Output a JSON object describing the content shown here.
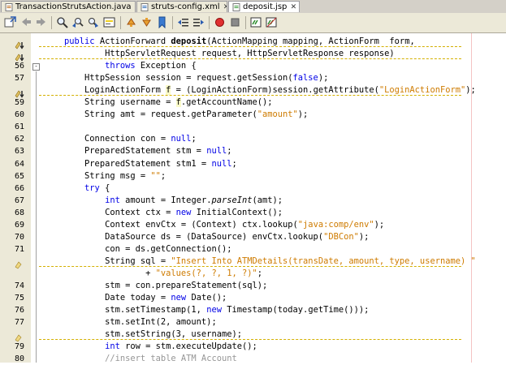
{
  "tabs": [
    {
      "label": "TransactionStrutsAction.java",
      "active": false,
      "icon": "java-file-icon"
    },
    {
      "label": "struts-config.xml",
      "active": false,
      "icon": "xml-file-icon"
    },
    {
      "label": "deposit.jsp",
      "active": true,
      "icon": "jsp-file-icon"
    }
  ],
  "toolbar": {
    "icons": [
      "go-to-source-icon",
      "back-icon",
      "forward-icon",
      "find-icon",
      "find-previous-icon",
      "find-next-icon",
      "toggle-highlight-icon",
      "previous-bookmark-icon",
      "next-bookmark-icon",
      "toggle-bookmark-icon",
      "shift-left-icon",
      "shift-right-icon",
      "start-macro-icon",
      "stop-macro-icon",
      "comment-icon",
      "uncomment-icon"
    ]
  },
  "lines": [
    {
      "n": "",
      "mark": "override",
      "tokens": [
        [
          "    "
        ],
        [
          "public",
          "kw"
        ],
        [
          " ActionForward "
        ],
        [
          "deposit",
          "mb"
        ],
        [
          "(ActionMapping mapping, ActionForm  form,"
        ]
      ]
    },
    {
      "n": "",
      "mark": "warning",
      "tokens": [
        [
          "            HttpServletRequest request, HttpServletResponse response)"
        ]
      ]
    },
    {
      "n": "56",
      "mark": "",
      "fold": "-",
      "tokens": [
        [
          "            "
        ],
        [
          "throws",
          "kw"
        ],
        [
          " Exception {"
        ]
      ]
    },
    {
      "n": "57",
      "mark": "",
      "tokens": [
        [
          "        HttpSession session = request.getSession("
        ],
        [
          "false",
          "kw"
        ],
        [
          ");"
        ]
      ]
    },
    {
      "n": "",
      "mark": "warning",
      "tokens": [
        [
          "        LoginActionForm "
        ],
        [
          "f",
          "hl"
        ],
        [
          " = (LoginActionForm)session.getAttribute("
        ],
        [
          "\"LoginActionForm\"",
          "st"
        ],
        [
          ");"
        ]
      ]
    },
    {
      "n": "59",
      "mark": "",
      "tokens": [
        [
          "        String username = "
        ],
        [
          "f",
          "hl"
        ],
        [
          ".getAccountName();"
        ]
      ]
    },
    {
      "n": "60",
      "mark": "",
      "tokens": [
        [
          "        String amt = request.getParameter("
        ],
        [
          "\"amount\"",
          "st"
        ],
        [
          ");"
        ]
      ]
    },
    {
      "n": "61",
      "mark": "",
      "tokens": [
        [
          ""
        ]
      ]
    },
    {
      "n": "62",
      "mark": "",
      "tokens": [
        [
          "        Connection con = "
        ],
        [
          "null",
          "kw"
        ],
        [
          ";"
        ]
      ]
    },
    {
      "n": "63",
      "mark": "",
      "tokens": [
        [
          "        PreparedStatement stm = "
        ],
        [
          "null",
          "kw"
        ],
        [
          ";"
        ]
      ]
    },
    {
      "n": "64",
      "mark": "",
      "tokens": [
        [
          "        PreparedStatement stm1 = "
        ],
        [
          "null",
          "kw"
        ],
        [
          ";"
        ]
      ]
    },
    {
      "n": "65",
      "mark": "",
      "tokens": [
        [
          "        String msg = "
        ],
        [
          "\"\"",
          "st"
        ],
        [
          ";"
        ]
      ]
    },
    {
      "n": "66",
      "mark": "",
      "tokens": [
        [
          "        "
        ],
        [
          "try",
          "kw"
        ],
        [
          " {"
        ]
      ]
    },
    {
      "n": "67",
      "mark": "",
      "tokens": [
        [
          "            "
        ],
        [
          "int",
          "kw"
        ],
        [
          " amount = Integer."
        ],
        [
          "parseInt",
          "it"
        ],
        [
          "(amt);"
        ]
      ]
    },
    {
      "n": "68",
      "mark": "",
      "tokens": [
        [
          "            Context ctx = "
        ],
        [
          "new",
          "kw"
        ],
        [
          " InitialContext();"
        ]
      ]
    },
    {
      "n": "69",
      "mark": "",
      "tokens": [
        [
          "            Context envCtx = (Context) ctx.lookup("
        ],
        [
          "\"java:comp/env\"",
          "st"
        ],
        [
          ");"
        ]
      ]
    },
    {
      "n": "70",
      "mark": "",
      "tokens": [
        [
          "            DataSource ds = (DataSource) envCtx.lookup("
        ],
        [
          "\"DBCon\"",
          "st"
        ],
        [
          ");"
        ]
      ]
    },
    {
      "n": "71",
      "mark": "",
      "tokens": [
        [
          "            con = ds.getConnection();"
        ]
      ]
    },
    {
      "n": "",
      "mark": "hint",
      "tokens": [
        [
          "            String sql = "
        ],
        [
          "\"Insert Into ATMDetails(transDate, amount, type, username) \"",
          "st"
        ]
      ]
    },
    {
      "n": "",
      "mark": "",
      "tokens": [
        [
          "                    + "
        ],
        [
          "\"values(?, ?, 1, ?)\"",
          "st"
        ],
        [
          ";"
        ]
      ]
    },
    {
      "n": "74",
      "mark": "",
      "tokens": [
        [
          "            stm = con.prepareStatement(sql);"
        ]
      ]
    },
    {
      "n": "75",
      "mark": "",
      "tokens": [
        [
          "            Date today = "
        ],
        [
          "new",
          "kw"
        ],
        [
          " Date();"
        ]
      ]
    },
    {
      "n": "76",
      "mark": "",
      "tokens": [
        [
          "            stm.setTimestamp(1, "
        ],
        [
          "new",
          "kw"
        ],
        [
          " Timestamp(today.getTime()));"
        ]
      ]
    },
    {
      "n": "77",
      "mark": "",
      "tokens": [
        [
          "            stm.setInt(2, amount);"
        ]
      ]
    },
    {
      "n": "",
      "mark": "hint",
      "tokens": [
        [
          "            stm.setString(3, username);"
        ]
      ]
    },
    {
      "n": "79",
      "mark": "",
      "tokens": [
        [
          "            "
        ],
        [
          "int",
          "kw"
        ],
        [
          " row = stm.executeUpdate();"
        ]
      ]
    },
    {
      "n": "80",
      "mark": "",
      "tokens": [
        [
          "            "
        ],
        [
          "//insert table ATM Account",
          "cm"
        ]
      ]
    }
  ]
}
